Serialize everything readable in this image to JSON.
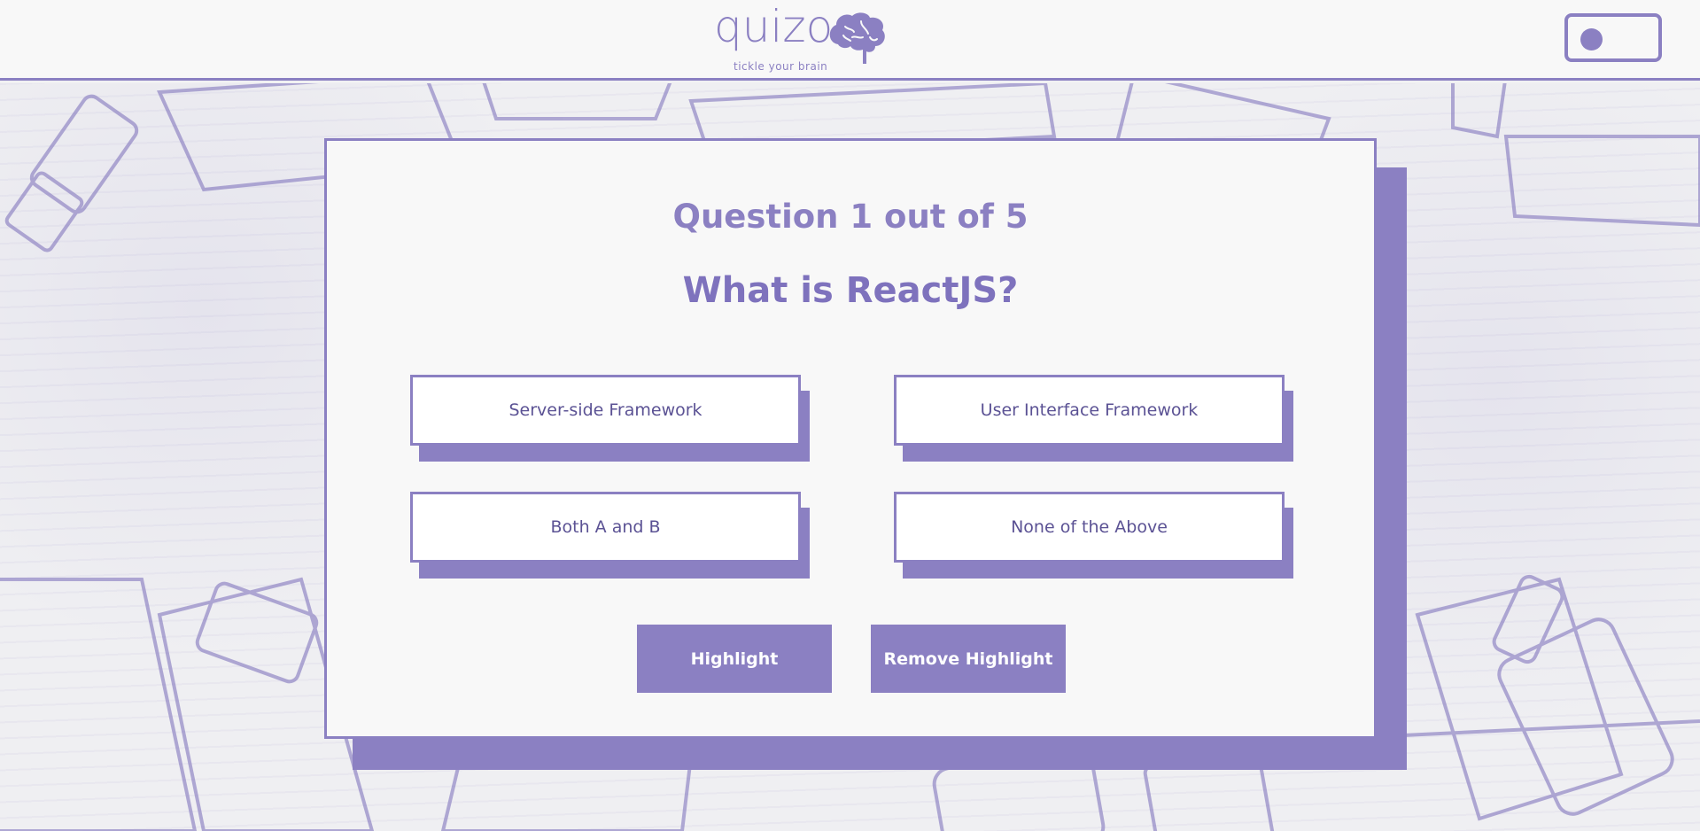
{
  "header": {
    "logo_text": "quizo",
    "tagline": "tickle your brain",
    "logo_icon": "brain-icon"
  },
  "theme_toggle": {
    "state": "off"
  },
  "quiz": {
    "progress": "Question 1 out of 5",
    "question": "What is ReactJS?",
    "options": [
      "Server-side Framework",
      "User Interface Framework",
      "Both A and B",
      "None of the Above"
    ],
    "actions": {
      "highlight": "Highlight",
      "remove_highlight": "Remove Highlight"
    }
  },
  "colors": {
    "accent": "#8b80c2",
    "text": "#5b5294",
    "surface": "#f8f8f8"
  }
}
